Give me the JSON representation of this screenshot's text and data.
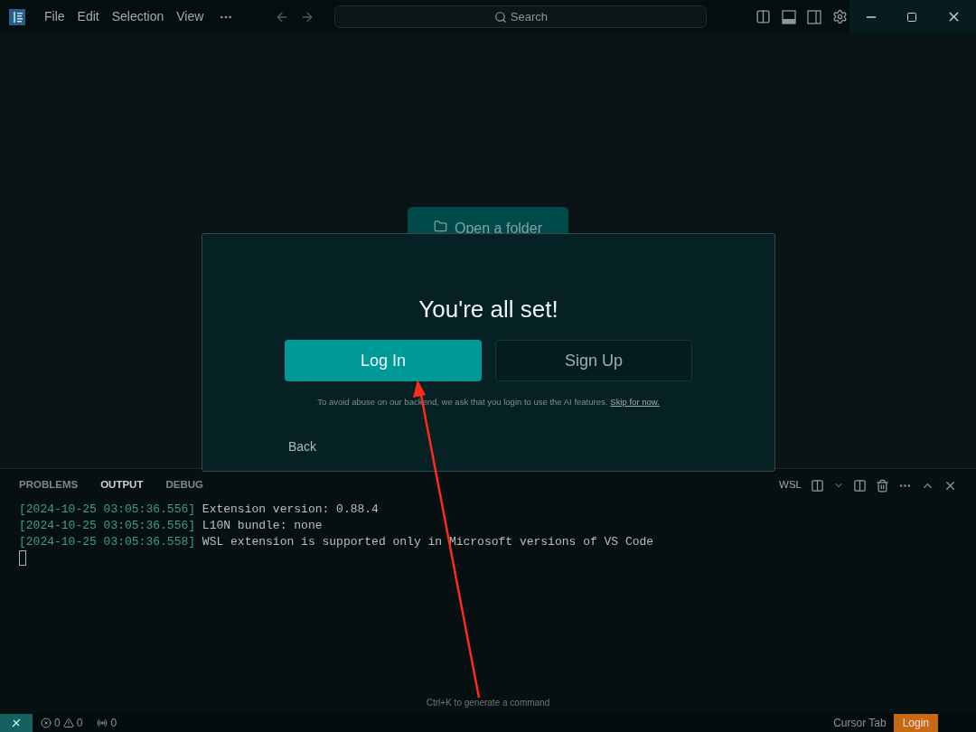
{
  "menu": [
    "File",
    "Edit",
    "Selection",
    "View"
  ],
  "search": {
    "placeholder": "Search"
  },
  "editor": {
    "open_folder": "Open a folder",
    "hint": "Ctrl+K to generate a command"
  },
  "panel": {
    "tabs": [
      {
        "label": "PROBLEMS",
        "selected": false
      },
      {
        "label": "OUTPUT",
        "selected": true
      },
      {
        "label": "DEBUG",
        "selected": false
      }
    ],
    "channel": "WSL",
    "lines": [
      {
        "time": "[2024-10-25 03:05:36.556]",
        "text": "Extension version: 0.88.4"
      },
      {
        "time": "[2024-10-25 03:05:36.556]",
        "text": "L10N bundle: none"
      },
      {
        "time": "[2024-10-25 03:05:36.558]",
        "text": "WSL extension is supported only in Microsoft versions of VS Code"
      }
    ]
  },
  "dialog": {
    "title": "You're all set!",
    "primary": "Log In",
    "secondary": "Sign Up",
    "note": "To avoid abuse on our backend, we ask that you login to use the AI features.",
    "skip": "Skip for now.",
    "back": "Back"
  },
  "status_bar": {
    "errors": "0",
    "warnings": "0",
    "ports": "0",
    "cursor_tab": "Cursor Tab",
    "login": "Login"
  }
}
